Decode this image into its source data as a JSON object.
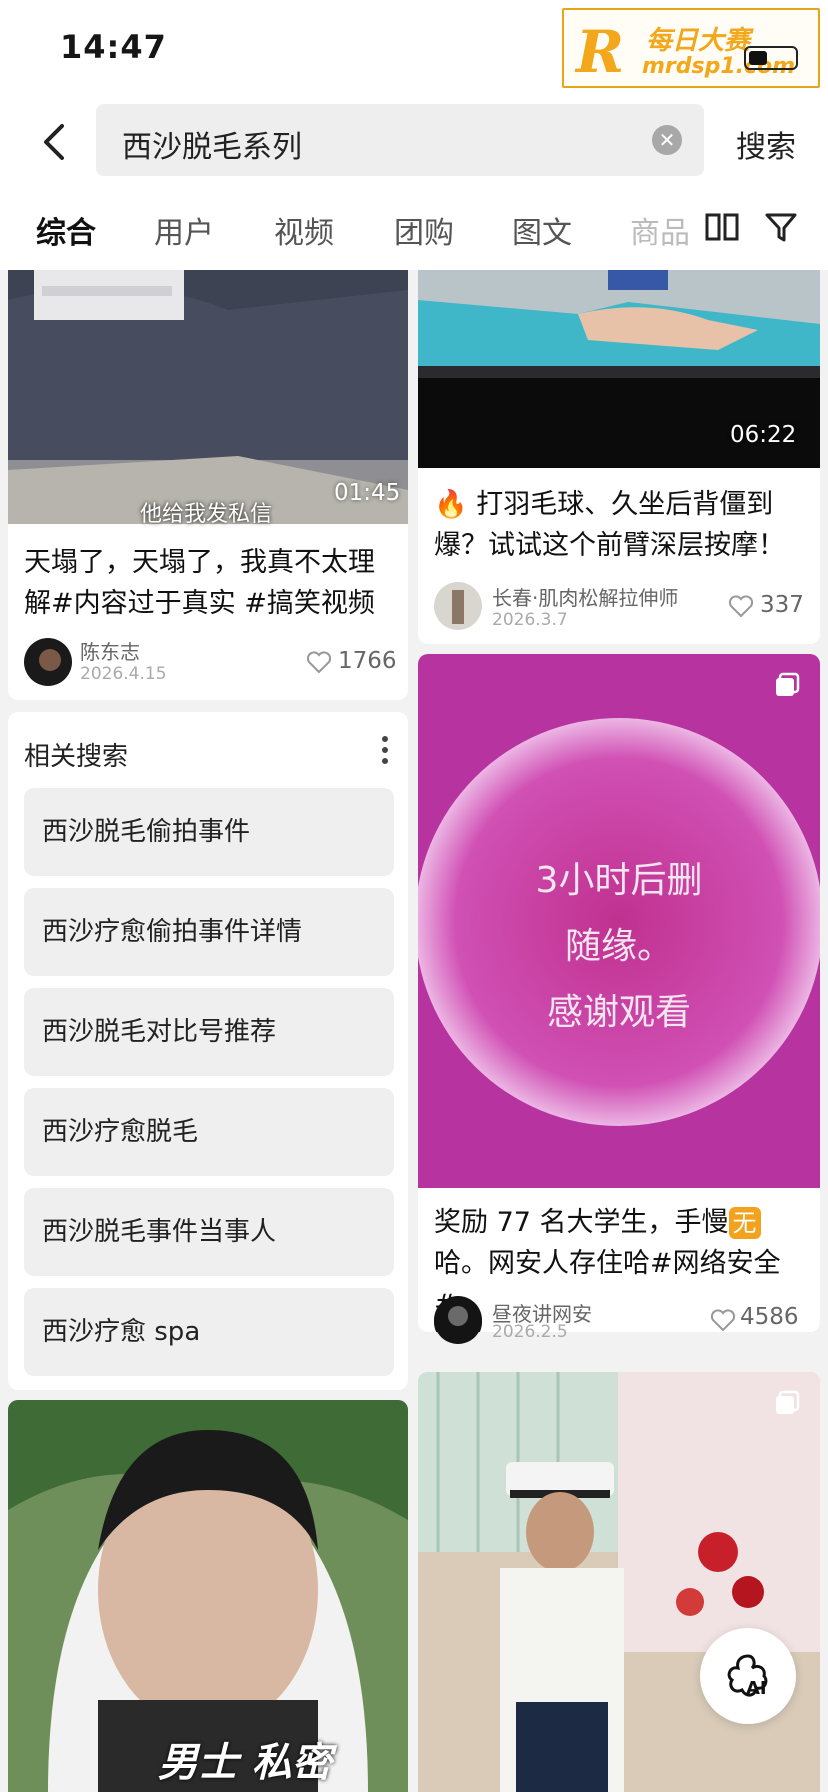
{
  "status": {
    "time": "14:47"
  },
  "watermark": {
    "letter": "R",
    "line1": "每日大赛",
    "line2": "mrdsp1.com"
  },
  "search": {
    "query": "西沙脱毛系列",
    "button": "搜索"
  },
  "tabs": [
    "综合",
    "用户",
    "视频",
    "团购",
    "图文",
    "商品"
  ],
  "feed": {
    "left_card": {
      "overlay": "他给我发私信",
      "duration": "01:45",
      "title": "天塌了，天塌了，我真不太理解#内容过于真实 #搞笑视频",
      "author": "陈东志",
      "date": "2026.4.15",
      "likes": "1766"
    },
    "right_card1": {
      "duration": "06:22",
      "title": "🔥 打羽毛球、久坐后背僵到爆？试试这个前臂深层按摩！",
      "author": "长春·肌肉松解拉伸师",
      "date": "2026.3.7",
      "likes": "337"
    },
    "right_card2": {
      "lines": [
        "3小时后删",
        "随缘。",
        "感谢观看"
      ],
      "title_a": "奖励 77 名大学生，手慢",
      "title_badge": "无",
      "title_b": "哈。网安人存住哈#网络安全 #...",
      "author": "昼夜讲网安",
      "date": "2026.2.5",
      "likes": "4586"
    },
    "left_card2": {
      "overlay": "男士 私密"
    }
  },
  "related": {
    "heading": "相关搜索",
    "items": [
      "西沙脱毛偷拍事件",
      "西沙疗愈偷拍事件详情",
      "西沙脱毛对比号推荐",
      "西沙疗愈脱毛",
      "西沙脱毛事件当事人",
      "西沙疗愈 spa"
    ]
  },
  "ai_button": {
    "label": "AI"
  },
  "colors": {
    "accent": "#f3a71b",
    "pink": "#c63aa8",
    "bg": "#f2f2f2"
  }
}
